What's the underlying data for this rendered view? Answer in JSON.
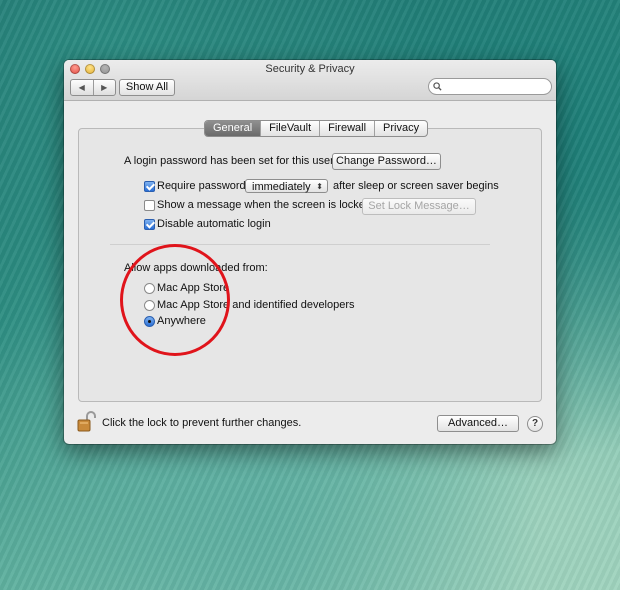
{
  "window": {
    "title": "Security & Privacy"
  },
  "toolbar": {
    "back_label": "◀",
    "forward_label": "▶",
    "show_all_label": "Show All",
    "search_placeholder": ""
  },
  "tabs": [
    {
      "label": "General",
      "active": true
    },
    {
      "label": "FileVault",
      "active": false
    },
    {
      "label": "Firewall",
      "active": false
    },
    {
      "label": "Privacy",
      "active": false
    }
  ],
  "general": {
    "login_password_text": "A login password has been set for this user",
    "change_password_button": "Change Password…",
    "require_password": {
      "label": "Require password",
      "checked": true
    },
    "require_password_delay": "immediately",
    "after_sleep_text": "after sleep or screen saver begins",
    "show_message": {
      "label": "Show a message when the screen is locked",
      "checked": false
    },
    "set_lock_message_button": "Set Lock Message…",
    "disable_auto_login": {
      "label": "Disable automatic login",
      "checked": true
    }
  },
  "allow_apps": {
    "heading": "Allow apps downloaded from:",
    "options": [
      {
        "label": "Mac App Store",
        "selected": false
      },
      {
        "label": "Mac App Store and identified developers",
        "selected": false
      },
      {
        "label": "Anywhere",
        "selected": true
      }
    ]
  },
  "footer": {
    "lock_text": "Click the lock to prevent further changes.",
    "advanced_button": "Advanced…",
    "help_label": "?"
  },
  "colors": {
    "annotation": "#e0141b",
    "checkbox_accent": "#2a6fd6",
    "active_tab": "#7a7a7a"
  },
  "icons": {
    "search": "search-icon",
    "lock": "lock-open-icon",
    "popup_arrows": "updown-arrows-icon"
  }
}
